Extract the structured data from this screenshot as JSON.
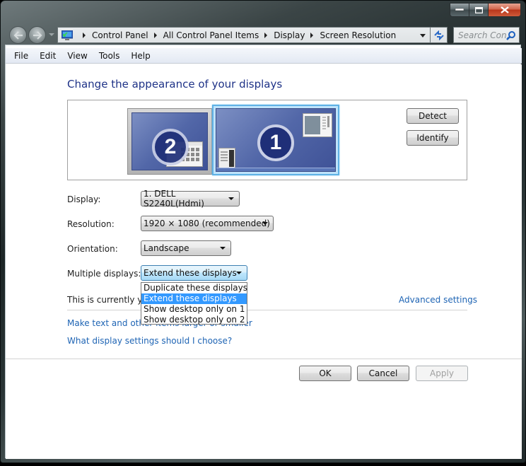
{
  "window": {
    "caption_buttons": [
      "minimize",
      "maximize",
      "close"
    ]
  },
  "navigation": {
    "back_icon": "back-arrow-icon",
    "forward_icon": "forward-arrow-icon",
    "breadcrumbs": [
      "Control Panel",
      "All Control Panel Items",
      "Display",
      "Screen Resolution"
    ],
    "search_placeholder": "Search Con...",
    "refresh_icon": "refresh-icon"
  },
  "menu": {
    "items": [
      "File",
      "Edit",
      "View",
      "Tools",
      "Help"
    ]
  },
  "page": {
    "title": "Change the appearance of your displays",
    "monitors": [
      {
        "number": "2",
        "selected": false
      },
      {
        "number": "1",
        "selected": true
      }
    ],
    "detect_label": "Detect",
    "identify_label": "Identify",
    "fields": {
      "display": {
        "label": "Display:",
        "value": "1. DELL S2240L(Hdmi)"
      },
      "resolution": {
        "label": "Resolution:",
        "value": "1920 × 1080 (recommended)"
      },
      "orientation": {
        "label": "Orientation:",
        "value": "Landscape"
      },
      "multiple_displays": {
        "label": "Multiple displays:",
        "value": "Extend these displays",
        "options": [
          "Duplicate these displays",
          "Extend these displays",
          "Show desktop only on 1",
          "Show desktop only on 2"
        ],
        "highlighted_index": 1
      }
    },
    "status_text": "This is currently your main display.",
    "advanced_settings": "Advanced settings",
    "links": {
      "text_size": "Make text and other items larger or smaller",
      "which_settings": "What display settings should I choose?"
    },
    "buttons": {
      "ok": "OK",
      "cancel": "Cancel",
      "apply": "Apply"
    }
  }
}
